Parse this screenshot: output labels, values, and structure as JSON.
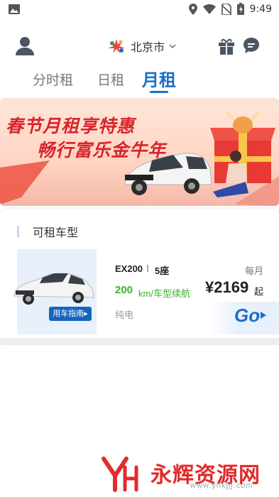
{
  "status_bar": {
    "time": "9:49"
  },
  "header": {
    "city": "北京市"
  },
  "tabs": [
    {
      "label": "分时租",
      "active": false
    },
    {
      "label": "日租",
      "active": false
    },
    {
      "label": "月租",
      "active": true
    }
  ],
  "banner": {
    "title": "春节月租享特惠",
    "subtitle": "畅行富乐金牛年"
  },
  "section": {
    "title": "可租车型"
  },
  "car": {
    "guide_label": "用车指南▸",
    "model": "EX200",
    "seats": "5座",
    "range_value": "200",
    "range_unit": "km/车型续航",
    "fuel_type": "纯电",
    "period": "每月",
    "price": "¥2169",
    "price_suffix": "起",
    "go_label": "Go"
  },
  "watermark": {
    "brand": "永辉资源网",
    "url": "www.yhkjjj.com"
  },
  "colors": {
    "accent": "#1a6fc9",
    "banner_red": "#d8242c",
    "range_green": "#3bb02c",
    "watermark_red": "#e22b2b"
  },
  "icons": [
    "image-icon",
    "location-icon",
    "wifi-icon",
    "no-sim-icon",
    "battery-icon",
    "avatar-icon",
    "city-logo-icon",
    "chevron-down-icon",
    "gift-icon",
    "chat-icon",
    "arrow-right-icon"
  ]
}
